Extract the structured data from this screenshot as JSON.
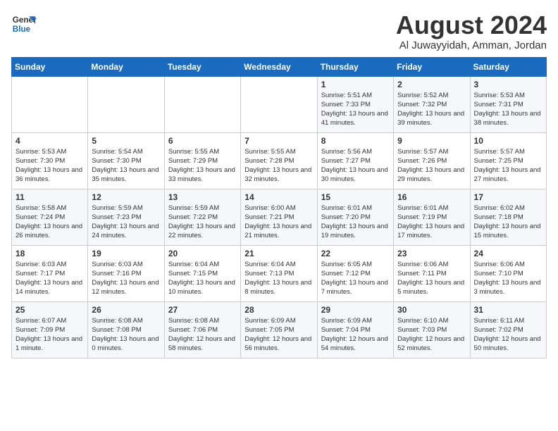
{
  "header": {
    "logo_line1": "General",
    "logo_line2": "Blue",
    "month_year": "August 2024",
    "location": "Al Juwayyidah, Amman, Jordan"
  },
  "days_of_week": [
    "Sunday",
    "Monday",
    "Tuesday",
    "Wednesday",
    "Thursday",
    "Friday",
    "Saturday"
  ],
  "weeks": [
    [
      {
        "day": "",
        "sunrise": "",
        "sunset": "",
        "daylight": ""
      },
      {
        "day": "",
        "sunrise": "",
        "sunset": "",
        "daylight": ""
      },
      {
        "day": "",
        "sunrise": "",
        "sunset": "",
        "daylight": ""
      },
      {
        "day": "",
        "sunrise": "",
        "sunset": "",
        "daylight": ""
      },
      {
        "day": "1",
        "sunrise": "Sunrise: 5:51 AM",
        "sunset": "Sunset: 7:33 PM",
        "daylight": "Daylight: 13 hours and 41 minutes."
      },
      {
        "day": "2",
        "sunrise": "Sunrise: 5:52 AM",
        "sunset": "Sunset: 7:32 PM",
        "daylight": "Daylight: 13 hours and 39 minutes."
      },
      {
        "day": "3",
        "sunrise": "Sunrise: 5:53 AM",
        "sunset": "Sunset: 7:31 PM",
        "daylight": "Daylight: 13 hours and 38 minutes."
      }
    ],
    [
      {
        "day": "4",
        "sunrise": "Sunrise: 5:53 AM",
        "sunset": "Sunset: 7:30 PM",
        "daylight": "Daylight: 13 hours and 36 minutes."
      },
      {
        "day": "5",
        "sunrise": "Sunrise: 5:54 AM",
        "sunset": "Sunset: 7:30 PM",
        "daylight": "Daylight: 13 hours and 35 minutes."
      },
      {
        "day": "6",
        "sunrise": "Sunrise: 5:55 AM",
        "sunset": "Sunset: 7:29 PM",
        "daylight": "Daylight: 13 hours and 33 minutes."
      },
      {
        "day": "7",
        "sunrise": "Sunrise: 5:55 AM",
        "sunset": "Sunset: 7:28 PM",
        "daylight": "Daylight: 13 hours and 32 minutes."
      },
      {
        "day": "8",
        "sunrise": "Sunrise: 5:56 AM",
        "sunset": "Sunset: 7:27 PM",
        "daylight": "Daylight: 13 hours and 30 minutes."
      },
      {
        "day": "9",
        "sunrise": "Sunrise: 5:57 AM",
        "sunset": "Sunset: 7:26 PM",
        "daylight": "Daylight: 13 hours and 29 minutes."
      },
      {
        "day": "10",
        "sunrise": "Sunrise: 5:57 AM",
        "sunset": "Sunset: 7:25 PM",
        "daylight": "Daylight: 13 hours and 27 minutes."
      }
    ],
    [
      {
        "day": "11",
        "sunrise": "Sunrise: 5:58 AM",
        "sunset": "Sunset: 7:24 PM",
        "daylight": "Daylight: 13 hours and 26 minutes."
      },
      {
        "day": "12",
        "sunrise": "Sunrise: 5:59 AM",
        "sunset": "Sunset: 7:23 PM",
        "daylight": "Daylight: 13 hours and 24 minutes."
      },
      {
        "day": "13",
        "sunrise": "Sunrise: 5:59 AM",
        "sunset": "Sunset: 7:22 PM",
        "daylight": "Daylight: 13 hours and 22 minutes."
      },
      {
        "day": "14",
        "sunrise": "Sunrise: 6:00 AM",
        "sunset": "Sunset: 7:21 PM",
        "daylight": "Daylight: 13 hours and 21 minutes."
      },
      {
        "day": "15",
        "sunrise": "Sunrise: 6:01 AM",
        "sunset": "Sunset: 7:20 PM",
        "daylight": "Daylight: 13 hours and 19 minutes."
      },
      {
        "day": "16",
        "sunrise": "Sunrise: 6:01 AM",
        "sunset": "Sunset: 7:19 PM",
        "daylight": "Daylight: 13 hours and 17 minutes."
      },
      {
        "day": "17",
        "sunrise": "Sunrise: 6:02 AM",
        "sunset": "Sunset: 7:18 PM",
        "daylight": "Daylight: 13 hours and 15 minutes."
      }
    ],
    [
      {
        "day": "18",
        "sunrise": "Sunrise: 6:03 AM",
        "sunset": "Sunset: 7:17 PM",
        "daylight": "Daylight: 13 hours and 14 minutes."
      },
      {
        "day": "19",
        "sunrise": "Sunrise: 6:03 AM",
        "sunset": "Sunset: 7:16 PM",
        "daylight": "Daylight: 13 hours and 12 minutes."
      },
      {
        "day": "20",
        "sunrise": "Sunrise: 6:04 AM",
        "sunset": "Sunset: 7:15 PM",
        "daylight": "Daylight: 13 hours and 10 minutes."
      },
      {
        "day": "21",
        "sunrise": "Sunrise: 6:04 AM",
        "sunset": "Sunset: 7:13 PM",
        "daylight": "Daylight: 13 hours and 8 minutes."
      },
      {
        "day": "22",
        "sunrise": "Sunrise: 6:05 AM",
        "sunset": "Sunset: 7:12 PM",
        "daylight": "Daylight: 13 hours and 7 minutes."
      },
      {
        "day": "23",
        "sunrise": "Sunrise: 6:06 AM",
        "sunset": "Sunset: 7:11 PM",
        "daylight": "Daylight: 13 hours and 5 minutes."
      },
      {
        "day": "24",
        "sunrise": "Sunrise: 6:06 AM",
        "sunset": "Sunset: 7:10 PM",
        "daylight": "Daylight: 13 hours and 3 minutes."
      }
    ],
    [
      {
        "day": "25",
        "sunrise": "Sunrise: 6:07 AM",
        "sunset": "Sunset: 7:09 PM",
        "daylight": "Daylight: 13 hours and 1 minute."
      },
      {
        "day": "26",
        "sunrise": "Sunrise: 6:08 AM",
        "sunset": "Sunset: 7:08 PM",
        "daylight": "Daylight: 13 hours and 0 minutes."
      },
      {
        "day": "27",
        "sunrise": "Sunrise: 6:08 AM",
        "sunset": "Sunset: 7:06 PM",
        "daylight": "Daylight: 12 hours and 58 minutes."
      },
      {
        "day": "28",
        "sunrise": "Sunrise: 6:09 AM",
        "sunset": "Sunset: 7:05 PM",
        "daylight": "Daylight: 12 hours and 56 minutes."
      },
      {
        "day": "29",
        "sunrise": "Sunrise: 6:09 AM",
        "sunset": "Sunset: 7:04 PM",
        "daylight": "Daylight: 12 hours and 54 minutes."
      },
      {
        "day": "30",
        "sunrise": "Sunrise: 6:10 AM",
        "sunset": "Sunset: 7:03 PM",
        "daylight": "Daylight: 12 hours and 52 minutes."
      },
      {
        "day": "31",
        "sunrise": "Sunrise: 6:11 AM",
        "sunset": "Sunset: 7:02 PM",
        "daylight": "Daylight: 12 hours and 50 minutes."
      }
    ]
  ]
}
